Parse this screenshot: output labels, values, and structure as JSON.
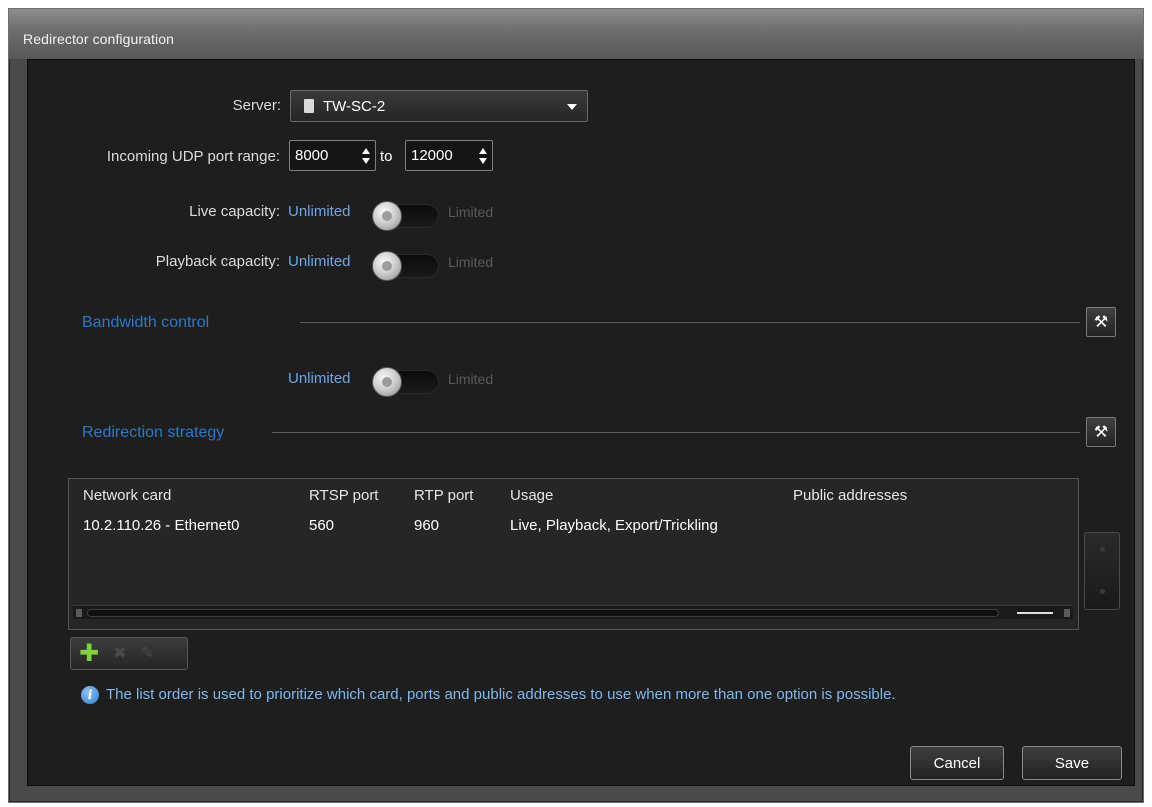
{
  "window": {
    "title": "Redirector configuration"
  },
  "server": {
    "label": "Server:",
    "value": "TW-SC-2"
  },
  "udp": {
    "label": "Incoming UDP port range:",
    "from": "8000",
    "to_label": "to",
    "to": "12000"
  },
  "live_capacity": {
    "label": "Live capacity:",
    "option_on": "Unlimited",
    "option_off": "Limited",
    "state": "Unlimited"
  },
  "playback_capacity": {
    "label": "Playback capacity:",
    "option_on": "Unlimited",
    "option_off": "Limited",
    "state": "Unlimited"
  },
  "bandwidth": {
    "title": "Bandwidth control",
    "option_on": "Unlimited",
    "option_off": "Limited",
    "state": "Unlimited"
  },
  "strategy": {
    "title": "Redirection strategy",
    "columns": [
      "Network card",
      "RTSP port",
      "RTP port",
      "Usage",
      "Public addresses"
    ],
    "rows": [
      {
        "network_card": "10.2.110.26 - Ethernet0",
        "rtsp_port": "560",
        "rtp_port": "960",
        "usage": "Live, Playback, Export/Trickling",
        "public_addresses": ""
      }
    ]
  },
  "info": "The list order is used to prioritize which card, ports and public addresses to use when more than one option is possible.",
  "buttons": {
    "cancel": "Cancel",
    "save": "Save"
  },
  "colors": {
    "accent": "#2b79c8",
    "info_text": "#7fb8ee",
    "add_green": "#7fd23a"
  },
  "icons": {
    "server": "server-icon",
    "info": "info-icon",
    "add": "plus-icon",
    "delete": "delete-icon",
    "edit": "edit-icon",
    "section_tools": "tools-icon"
  }
}
